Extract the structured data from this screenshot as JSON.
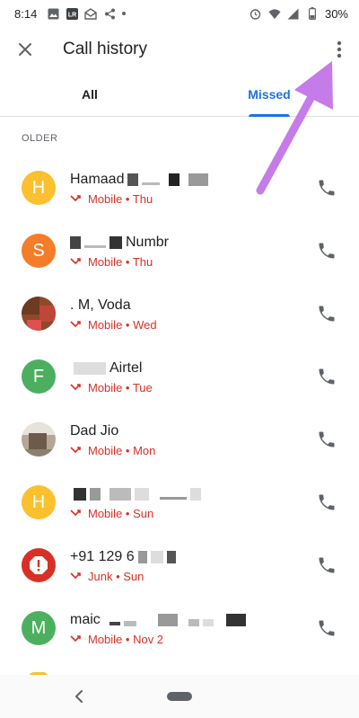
{
  "status_bar": {
    "time": "8:14",
    "battery": "30%",
    "icons": [
      "image-icon",
      "lr-app-icon",
      "mail-icon",
      "share-icon",
      "dot-icon",
      "alarm-icon",
      "wifi-icon",
      "signal-icon",
      "battery-icon"
    ]
  },
  "app_bar": {
    "title": "Call history",
    "close_icon": "close-icon",
    "overflow_icon": "more-vert-icon"
  },
  "tabs": [
    {
      "label": "All",
      "active": false
    },
    {
      "label": "Missed",
      "active": true
    }
  ],
  "section": {
    "label": "OLDER"
  },
  "calls": [
    {
      "name": "Hamaad",
      "meta": "Mobile • Thu",
      "avatar_letter": "H",
      "avatar_color": "#fbc02d",
      "avatar_type": "letter"
    },
    {
      "name": "Numbr",
      "meta": "Mobile • Thu",
      "avatar_letter": "S",
      "avatar_color": "#f57c29",
      "avatar_type": "letter"
    },
    {
      "name": ". M, Voda",
      "meta": "Mobile • Wed",
      "avatar_letter": "",
      "avatar_color": "#8d4a2b",
      "avatar_type": "photo"
    },
    {
      "name": "Airtel",
      "meta": "Mobile • Tue",
      "avatar_letter": "F",
      "avatar_color": "#4caf60",
      "avatar_type": "letter"
    },
    {
      "name": "Dad Jio",
      "meta": "Mobile • Mon",
      "avatar_letter": "",
      "avatar_color": "#9e8a7a",
      "avatar_type": "photo"
    },
    {
      "name": "",
      "meta": "Mobile • Sun",
      "avatar_letter": "H",
      "avatar_color": "#fbc02d",
      "avatar_type": "letter"
    },
    {
      "name": "+91 129 6",
      "meta": "Junk • Sun",
      "avatar_letter": "!",
      "avatar_color": "#d93025",
      "avatar_type": "alert"
    },
    {
      "name": "maic",
      "meta": "Mobile • Nov 2",
      "avatar_letter": "M",
      "avatar_color": "#4caf60",
      "avatar_type": "letter"
    }
  ],
  "colors": {
    "accent": "#1a73e8",
    "missed": "#d93025",
    "annotation_arrow": "#c57ce8"
  }
}
